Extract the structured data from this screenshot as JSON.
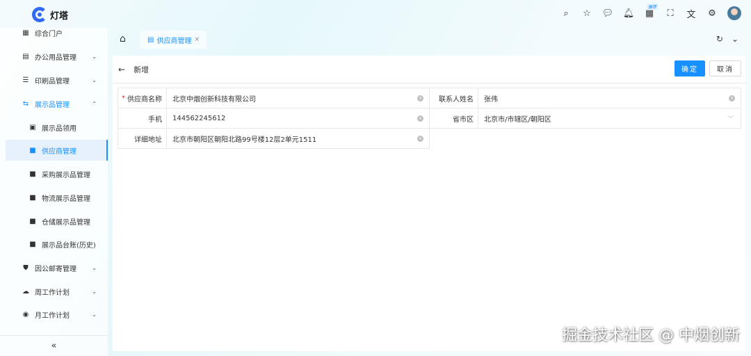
{
  "app": {
    "name": "灯塔"
  },
  "topbar": {
    "icons": [
      "search-icon",
      "star-icon",
      "message-icon",
      "bell-icon",
      "apps-icon",
      "fullscreen-icon",
      "translate-icon",
      "gear-icon",
      "avatar"
    ],
    "badge": "推荐"
  },
  "sidebar": {
    "items": [
      {
        "label": "综合门户",
        "icon": "grid-icon"
      },
      {
        "label": "办公用品管理",
        "icon": "clipboard-icon"
      },
      {
        "label": "印刷品管理",
        "icon": "list-icon"
      },
      {
        "label": "展示品管理",
        "icon": "flow-icon"
      },
      {
        "label": "展示品领用",
        "icon": "doc-icon"
      },
      {
        "label": "供应商管理",
        "icon": "doc-icon"
      },
      {
        "label": "采购展示品管理",
        "icon": "doc-icon"
      },
      {
        "label": "物流展示品管理",
        "icon": "doc-icon"
      },
      {
        "label": "仓储展示品管理",
        "icon": "doc-icon"
      },
      {
        "label": "展示品台账(历史)",
        "icon": "doc-icon"
      },
      {
        "label": "因公邮寄管理",
        "icon": "shield-icon"
      },
      {
        "label": "周工作计划",
        "icon": "cloud-upload-icon"
      },
      {
        "label": "月工作计划",
        "icon": "eye-icon"
      }
    ],
    "collapse": "«"
  },
  "tabs": {
    "active": "供应商管理"
  },
  "page": {
    "title": "新增",
    "confirm": "确定",
    "cancel": "取消"
  },
  "form": {
    "supplier_name": {
      "label": "供应商名称",
      "value": "北京中烟创新科技有限公司"
    },
    "contact": {
      "label": "联系人姓名",
      "value": "张伟"
    },
    "phone": {
      "label": "手机",
      "value": "144562245612"
    },
    "region": {
      "label": "省市区",
      "value": "北京市/市辖区/朝阳区"
    },
    "address": {
      "label": "详细地址",
      "value": "北京市朝阳区朝阳北路99号楼12层2单元1511"
    }
  },
  "watermark": "掘金技术社区 @ 中烟创新"
}
